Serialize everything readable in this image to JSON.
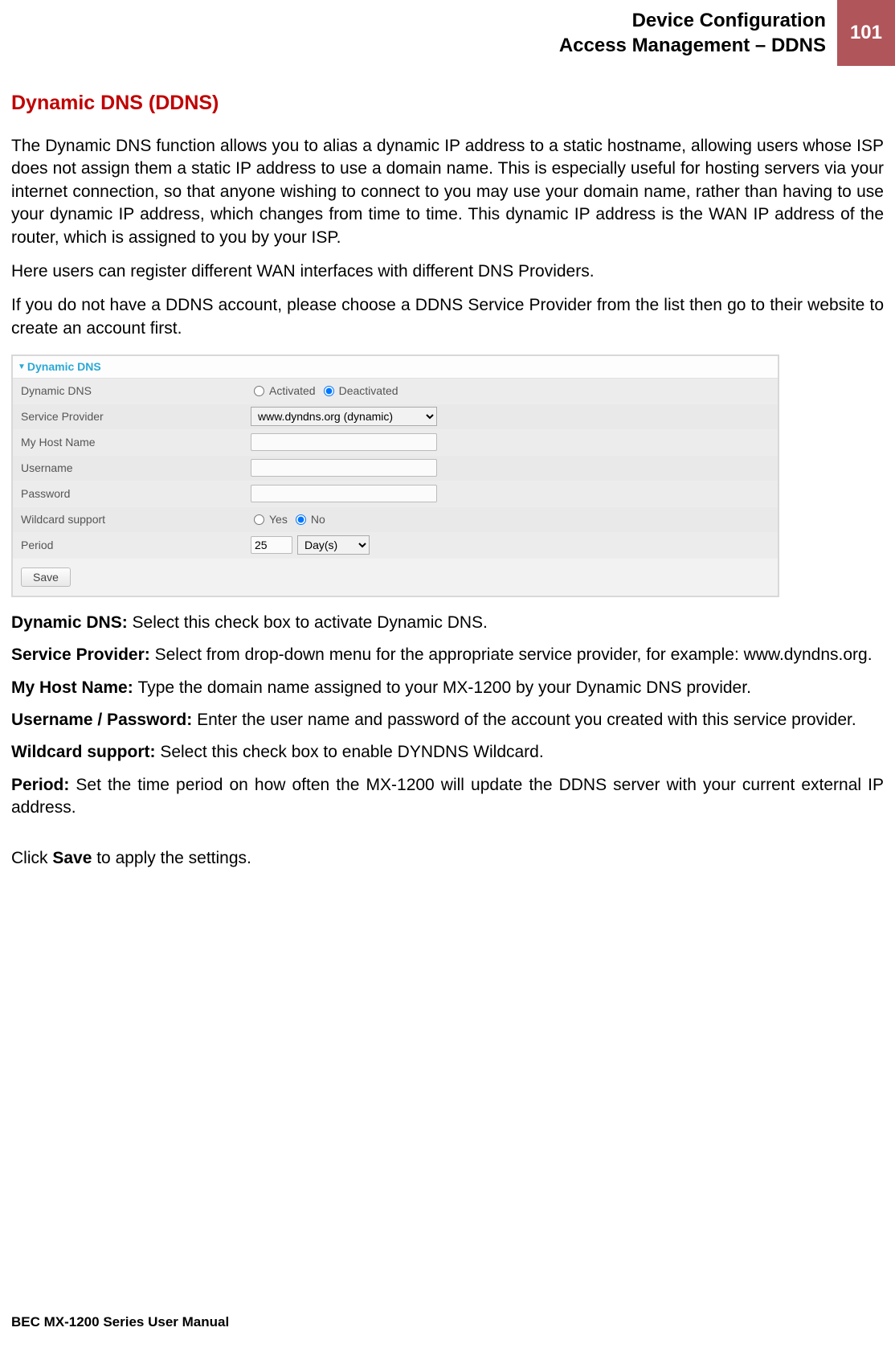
{
  "header": {
    "line1": "Device Configuration",
    "line2": "Access Management – DDNS",
    "page_number": "101"
  },
  "section_title": "Dynamic DNS (DDNS)",
  "intro": {
    "p1": "The Dynamic DNS function allows you to alias a dynamic IP address to a static hostname, allowing users whose ISP does not assign them a static IP address to use a domain name. This is especially useful for hosting servers via your internet connection, so that anyone wishing to connect to you may use your domain name, rather than having to use your dynamic IP address, which changes from time to time. This dynamic IP address is the WAN IP address of the router, which is assigned to you by your ISP.",
    "p2": "Here users can register different WAN interfaces with different DNS Providers.",
    "p3": "If you do not have a DDNS account, please choose a DDNS Service Provider from the list then go to their website to create an account first."
  },
  "panel": {
    "title": "Dynamic DNS",
    "rows": {
      "dynamic_dns": {
        "label": "Dynamic DNS",
        "opt_activated": "Activated",
        "opt_deactivated": "Deactivated"
      },
      "service_provider": {
        "label": "Service Provider",
        "value": "www.dyndns.org (dynamic)"
      },
      "hostname": {
        "label": "My Host Name",
        "value": ""
      },
      "username": {
        "label": "Username",
        "value": ""
      },
      "password": {
        "label": "Password",
        "value": ""
      },
      "wildcard": {
        "label": "Wildcard support",
        "opt_yes": "Yes",
        "opt_no": "No"
      },
      "period": {
        "label": "Period",
        "value": "25",
        "unit": "Day(s)"
      }
    },
    "save_btn": "Save"
  },
  "descriptions": {
    "dyn_dns_k": "Dynamic DNS: ",
    "dyn_dns_v": "Select this check box to activate Dynamic DNS.",
    "sp_k": "Service Provider: ",
    "sp_v": "Select from drop-down menu for the appropriate service provider, for example: www.dyndns.org.",
    "host_k": "My Host Name: ",
    "host_v": "Type the domain name assigned to your MX-1200 by your Dynamic DNS provider.",
    "up_k": "Username / Password: ",
    "up_v": "Enter the user name and password of the account you created with this service provider.",
    "wc_k": "Wildcard support: ",
    "wc_v": "Select this check box to enable DYNDNS Wildcard.",
    "period_k": "Period: ",
    "period_v": "Set the time period on how often the MX-1200 will update the DDNS server with your current external IP address."
  },
  "closing": {
    "pre": "Click ",
    "bold": "Save",
    "post": " to apply the settings."
  },
  "footer": "BEC MX-1200 Series User Manual"
}
